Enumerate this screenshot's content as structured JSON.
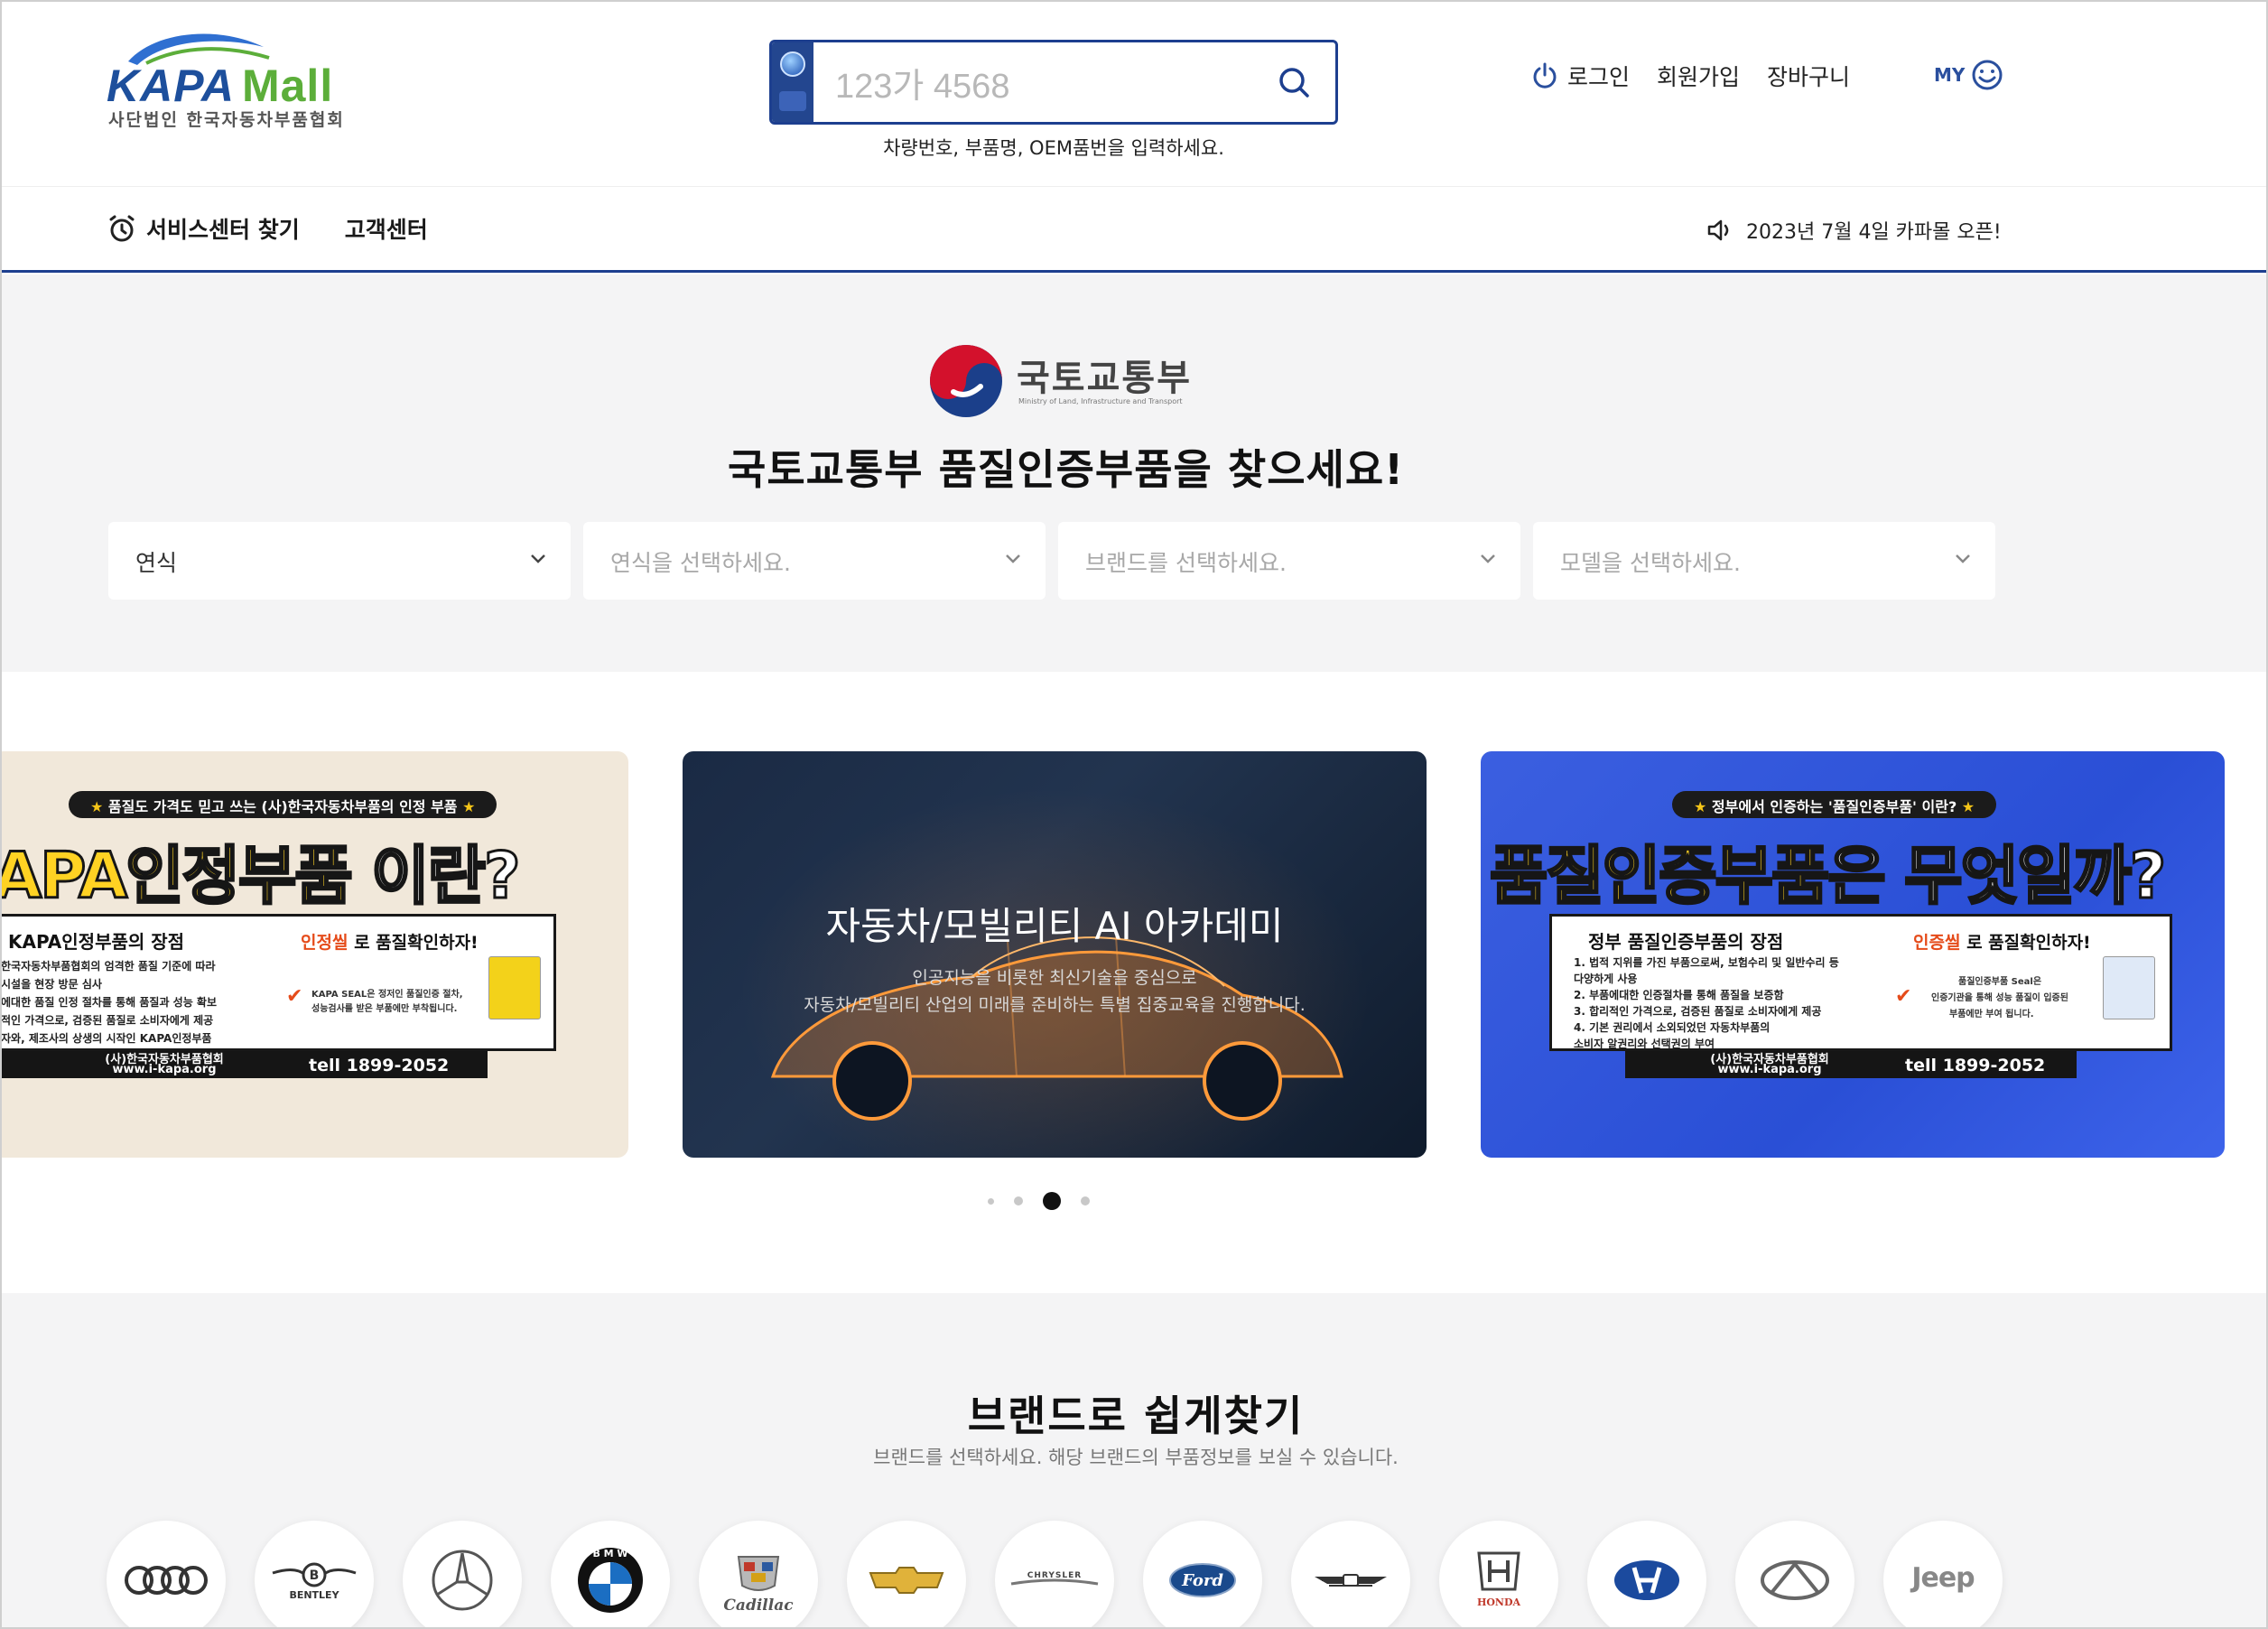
{
  "header": {
    "logo_kapa": "KAPA",
    "logo_mall": "Mall",
    "logo_sub": "사단법인 한국자동차부품협회",
    "search_placeholder": "1237\u0000 4568",
    "search_value": "123가 4568",
    "search_hint": "차량번호, 부품명, OEM품번을 입력하세요.",
    "nav": {
      "login": "로그인",
      "signup": "회원가입",
      "cart": "장바구니",
      "my": "MY"
    }
  },
  "subnav": {
    "service_center": "서비스센터 찾기",
    "customer_center": "고객센터",
    "notice": "2023년 7월 4일 카파몰 오픈!"
  },
  "ministry": {
    "name": "국토교통부",
    "name_en": "Ministry of Land, Infrastructure and Transport",
    "title": "국토교통부 품질인증부품을 찾으세요!",
    "selects": [
      {
        "label": "연식",
        "style": "dark"
      },
      {
        "label": "연식을 선택하세요.",
        "style": "light"
      },
      {
        "label": "브랜드를 선택하세요.",
        "style": "light"
      },
      {
        "label": "모델을 선택하세요.",
        "style": "light"
      }
    ]
  },
  "banners": {
    "b1": {
      "pill": "품질도 가격도 믿고 쓰는 (사)한국자동차부품의 인정 부품",
      "headline_a": "APA인정부품",
      "headline_b": "이란?",
      "card_title": "KAPA인정부품의 장점",
      "lines": [
        "한국자동차부품협회의 엄격한 품질 기준에 따라",
        "시설을 현장 방문 심사",
        "에대한 품질 인정 절차를 통해 품질과 성능 확보",
        "적인 가격으로, 검증된 품질로 소비자에게 제공",
        "자와, 제조사의 상생의 시작인 KAPA인정부품"
      ],
      "stamp_hl": "인정씰",
      "stamp_rest": "로 품질확인하자!",
      "seal_text_1": "KAPA SEAL은 정저인 품질인증 절차,",
      "seal_text_2": "성능검사를 받은 부품에만 부착됩니다.",
      "org": "(사)한국자동차부품협회",
      "org_url": "www.i-kapa.org",
      "tel": "tell 1899-2052"
    },
    "b2": {
      "title": "자동차/모빌리티 AI 아카데미",
      "desc_1": "인공지능을 비롯한 최신기술을 중심으로",
      "desc_2": "자동차/모빌리티 산업의 미래를 준비하는 특별 집중교육을 진행합니다."
    },
    "b3": {
      "pill": "정부에서 인증하는 '품질인증부품' 이란?",
      "headline_a": "품질인증부품",
      "headline_b": "은 무엇일까?",
      "card_title": "정부 품질인증부품의 장점",
      "lines": [
        "1. 법적 지위를 가진 부품으로써, 보험수리 및 일반수리 등",
        "   다양하게 사용",
        "2. 부품에대한 인증절차를 통해 품질을 보증함",
        "3. 합리적인 가격으로, 검증된 품질로 소비자에게 제공",
        "4. 기본 권리에서 소외되었던 자동차부품의",
        "   소비자 알권리와 선택권의 부여"
      ],
      "stamp_hl": "인증씰",
      "stamp_rest": "로 품질확인하자!",
      "seal_text_1": "품질인증부품 Seal은",
      "seal_text_2": "인증기관을 통해 성능 품질이 입증된",
      "seal_text_3": "부품에만 부여 됩니다.",
      "org": "(사)한국자동차부품협회",
      "org_url": "www.i-kapa.org",
      "tel": "tell 1899-2052"
    }
  },
  "brands": {
    "title": "브랜드로 쉽게찾기",
    "subtitle": "브랜드를 선택하세요. 해당 브랜드의 부품정보를 보실 수 있습니다.",
    "items": [
      "audi",
      "bentley",
      "mercedes-benz",
      "bmw",
      "cadillac",
      "chevrolet",
      "chrysler",
      "ford",
      "genesis",
      "honda",
      "hyundai",
      "infiniti",
      "jeep"
    ],
    "bentley_text": "BENTLEY",
    "bmw_text": "B M W",
    "cadillac_text": "Cadillac",
    "chrysler_text": "CHRYSLER",
    "ford_text": "Ford",
    "honda_text": "HONDA",
    "jeep_text": "Jeep"
  },
  "colors": {
    "brand_blue": "#1d3f8f",
    "logo_green": "#5cae3a",
    "banner_yellow": "#ffd223"
  }
}
